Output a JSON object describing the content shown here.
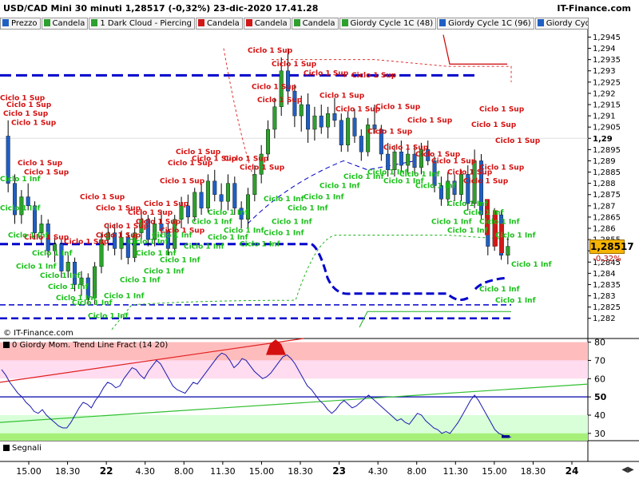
{
  "header": {
    "title": "USD/CAD Mini 30 minuti 1,28517 (-0,32%) 23-dic-2020 17.41.28",
    "brand": "IT-Finance.com"
  },
  "legend_tabs": [
    {
      "label": "Prezzo",
      "color": "#1f5fc4"
    },
    {
      "label": "Candela",
      "color": "#2ea02e"
    },
    {
      "label": "1 Dark Cloud - Piercing",
      "color": "#2ea02e"
    },
    {
      "label": "Candela",
      "color": "#d01818"
    },
    {
      "label": "Candela",
      "color": "#d01818"
    },
    {
      "label": "Candela",
      "color": "#2ea02e"
    },
    {
      "label": "Giordy Cycle 1C (48)",
      "color": "#2ea02e"
    },
    {
      "label": "Giordy Cycle 1C (96)",
      "color": "#1f5fc4"
    },
    {
      "label": "Giordy Cycle",
      "color": "#1f5fc4"
    }
  ],
  "price_axis": {
    "ticks": [
      "1,2945",
      "1,294",
      "1,2935",
      "1,293",
      "1,2925",
      "1,292",
      "1,2915",
      "1,291",
      "1,2905",
      "1,29",
      "1,2895",
      "1,289",
      "1,2885",
      "1,288",
      "1,2875",
      "1,287",
      "1,2865",
      "1,286",
      "1,2855",
      "1,285",
      "1,2845",
      "1,284",
      "1,2835",
      "1,283",
      "1,2825",
      "1,282"
    ],
    "current": "1,28517",
    "change": "-0,32%"
  },
  "copyright": "© IT-Finance.com",
  "oscillator": {
    "title": "0 Giordy Mom. Trend Line Fract (14 20)",
    "ticks": [
      "80",
      "70",
      "60",
      "50",
      "40",
      "30"
    ]
  },
  "signals_label": "Segnali",
  "x_axis": {
    "labels": [
      {
        "t": "15.00",
        "bold": false
      },
      {
        "t": "18.30",
        "bold": false
      },
      {
        "t": "22",
        "bold": true
      },
      {
        "t": "4.30",
        "bold": false
      },
      {
        "t": "8.00",
        "bold": false
      },
      {
        "t": "11.30",
        "bold": false
      },
      {
        "t": "15.00",
        "bold": false
      },
      {
        "t": "18.30",
        "bold": false
      },
      {
        "t": "23",
        "bold": true
      },
      {
        "t": "4.30",
        "bold": false
      },
      {
        "t": "8.00",
        "bold": false
      },
      {
        "t": "11.30",
        "bold": false
      },
      {
        "t": "15.00",
        "bold": false
      },
      {
        "t": "18.30",
        "bold": false
      },
      {
        "t": "24",
        "bold": true
      }
    ]
  },
  "annotations": {
    "sup": "Ciclo 1 Sup",
    "inf": "Ciclo 1 Inf"
  },
  "chart_data": [
    {
      "type": "candlestick",
      "title": "USD/CAD Mini 30 minuti",
      "ylim": [
        1.2816,
        1.2948
      ],
      "candles": [
        [
          1.2901,
          1.2908,
          1.2876,
          1.288
        ],
        [
          1.288,
          1.2884,
          1.2862,
          1.2866
        ],
        [
          1.2866,
          1.2877,
          1.2862,
          1.2874
        ],
        [
          1.2874,
          1.288,
          1.2868,
          1.287
        ],
        [
          1.287,
          1.2872,
          1.2855,
          1.2858
        ],
        [
          1.2858,
          1.2866,
          1.2853,
          1.2862
        ],
        [
          1.2862,
          1.2864,
          1.2847,
          1.285
        ],
        [
          1.285,
          1.2856,
          1.2845,
          1.2853
        ],
        [
          1.2853,
          1.2855,
          1.2838,
          1.2841
        ],
        [
          1.2841,
          1.2848,
          1.2838,
          1.2845
        ],
        [
          1.2845,
          1.2847,
          1.2832,
          1.2835
        ],
        [
          1.2835,
          1.2841,
          1.283,
          1.2838
        ],
        [
          1.2838,
          1.284,
          1.2826,
          1.2829
        ],
        [
          1.2829,
          1.2845,
          1.2826,
          1.2843
        ],
        [
          1.2843,
          1.2858,
          1.284,
          1.2855
        ],
        [
          1.2855,
          1.2862,
          1.285,
          1.2858
        ],
        [
          1.2858,
          1.2862,
          1.2848,
          1.2851
        ],
        [
          1.2851,
          1.2859,
          1.2846,
          1.2856
        ],
        [
          1.2856,
          1.2858,
          1.2844,
          1.2847
        ],
        [
          1.2847,
          1.286,
          1.2845,
          1.2858
        ],
        [
          1.2858,
          1.2868,
          1.2855,
          1.2864
        ],
        [
          1.2864,
          1.2866,
          1.2852,
          1.2855
        ],
        [
          1.2855,
          1.2865,
          1.2852,
          1.2862
        ],
        [
          1.2862,
          1.2868,
          1.2856,
          1.2859
        ],
        [
          1.2859,
          1.2862,
          1.2848,
          1.2851
        ],
        [
          1.2851,
          1.2866,
          1.2849,
          1.2864
        ],
        [
          1.2864,
          1.2874,
          1.286,
          1.287
        ],
        [
          1.287,
          1.2875,
          1.2862,
          1.2865
        ],
        [
          1.2865,
          1.2878,
          1.2863,
          1.2876
        ],
        [
          1.2876,
          1.288,
          1.2866,
          1.2869
        ],
        [
          1.2869,
          1.2884,
          1.2867,
          1.2881
        ],
        [
          1.2881,
          1.2886,
          1.2872,
          1.2875
        ],
        [
          1.2875,
          1.288,
          1.2868,
          1.2872
        ],
        [
          1.2872,
          1.2884,
          1.2868,
          1.288
        ],
        [
          1.288,
          1.2883,
          1.2866,
          1.2869
        ],
        [
          1.2869,
          1.2872,
          1.286,
          1.2864
        ],
        [
          1.2864,
          1.2878,
          1.286,
          1.2875
        ],
        [
          1.2875,
          1.2888,
          1.2872,
          1.2884
        ],
        [
          1.2884,
          1.2897,
          1.288,
          1.2893
        ],
        [
          1.2893,
          1.2908,
          1.289,
          1.2904
        ],
        [
          1.2904,
          1.2918,
          1.29,
          1.2914
        ],
        [
          1.2914,
          1.2936,
          1.291,
          1.293
        ],
        [
          1.293,
          1.294,
          1.2915,
          1.2921
        ],
        [
          1.2921,
          1.2924,
          1.2905,
          1.291
        ],
        [
          1.291,
          1.2919,
          1.2903,
          1.2915
        ],
        [
          1.2915,
          1.292,
          1.2898,
          1.2904
        ],
        [
          1.2904,
          1.2914,
          1.2899,
          1.291
        ],
        [
          1.291,
          1.2915,
          1.2902,
          1.2905
        ],
        [
          1.2905,
          1.2914,
          1.29,
          1.2911
        ],
        [
          1.2911,
          1.2918,
          1.2905,
          1.2908
        ],
        [
          1.2908,
          1.2911,
          1.2894,
          1.2897
        ],
        [
          1.2897,
          1.2912,
          1.2894,
          1.2909
        ],
        [
          1.2909,
          1.2913,
          1.2898,
          1.2901
        ],
        [
          1.2901,
          1.2904,
          1.289,
          1.2894
        ],
        [
          1.2894,
          1.2909,
          1.2892,
          1.2906
        ],
        [
          1.2906,
          1.2915,
          1.2902,
          1.2904
        ],
        [
          1.2904,
          1.2906,
          1.289,
          1.2893
        ],
        [
          1.2893,
          1.2898,
          1.2883,
          1.2886
        ],
        [
          1.2886,
          1.2897,
          1.2883,
          1.2894
        ],
        [
          1.2894,
          1.2899,
          1.2885,
          1.2888
        ],
        [
          1.2888,
          1.2896,
          1.2884,
          1.2893
        ],
        [
          1.2893,
          1.2897,
          1.2884,
          1.2887
        ],
        [
          1.2887,
          1.2898,
          1.2884,
          1.2895
        ],
        [
          1.2895,
          1.2899,
          1.2888,
          1.289
        ],
        [
          1.289,
          1.2892,
          1.2876,
          1.2879
        ],
        [
          1.2879,
          1.2883,
          1.287,
          1.2873
        ],
        [
          1.2873,
          1.2885,
          1.287,
          1.2881
        ],
        [
          1.2881,
          1.2884,
          1.2872,
          1.2875
        ],
        [
          1.2875,
          1.2886,
          1.2872,
          1.2884
        ],
        [
          1.2884,
          1.2888,
          1.2868,
          1.2871
        ],
        [
          1.2871,
          1.2895,
          1.2869,
          1.289
        ],
        [
          1.289,
          1.2893,
          1.2864,
          1.2866
        ],
        [
          1.2866,
          1.287,
          1.2848,
          1.2852
        ],
        [
          1.2852,
          1.2869,
          1.285,
          1.2866
        ],
        [
          1.2866,
          1.2868,
          1.2846,
          1.2848
        ],
        [
          1.2848,
          1.2856,
          1.2844,
          1.2852
        ]
      ]
    },
    {
      "type": "line",
      "title": "0 Giordy Mom. Trend Line Fract (14 20)",
      "ylim": [
        26,
        82
      ],
      "levels": [
        80,
        70,
        60,
        50,
        40,
        30
      ],
      "series": [
        {
          "values": [
            65,
            62,
            58,
            55,
            52,
            50,
            47,
            45,
            42,
            41,
            43,
            40,
            38,
            36,
            34,
            33,
            33,
            36,
            40,
            44,
            47,
            46,
            44,
            48,
            51,
            55,
            58,
            57,
            55,
            56,
            60,
            63,
            66,
            65,
            62,
            60,
            64,
            67,
            70,
            68,
            64,
            60,
            56,
            54,
            53,
            52,
            55,
            58,
            57,
            60,
            63,
            66,
            69,
            72,
            74,
            73,
            70,
            66,
            68,
            71,
            70,
            67,
            64,
            62,
            60,
            61,
            63,
            66,
            69,
            72,
            73,
            71,
            68,
            64,
            60,
            56,
            54,
            51,
            48,
            46,
            43,
            41,
            43,
            46,
            48,
            46,
            44,
            45,
            47,
            49,
            51,
            49,
            47,
            45,
            43,
            41,
            39,
            37,
            38,
            36,
            35,
            38,
            41,
            40,
            37,
            35,
            33,
            32,
            30,
            31,
            30,
            33,
            36,
            40,
            44,
            48,
            51,
            48,
            44,
            40,
            36,
            32,
            30,
            29,
            28,
            28
          ]
        }
      ]
    }
  ]
}
